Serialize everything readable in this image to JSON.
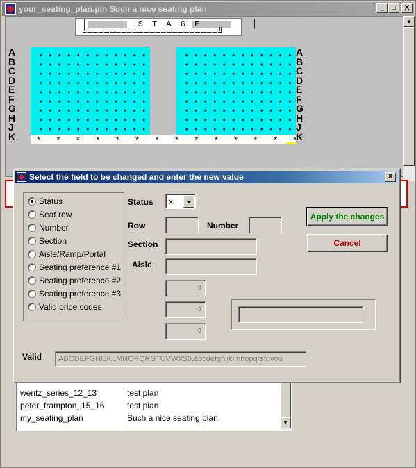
{
  "window": {
    "title": "your_seating_plan.pln Such a nice seating plan",
    "buttons": {
      "minimize": "_",
      "maximize": "□",
      "close": "X"
    }
  },
  "stage": {
    "line1": "║       S T A G E       ║",
    "line2": "╚═══════════════════════╝"
  },
  "rows": [
    "A",
    "B",
    "C",
    "D",
    "E",
    "F",
    "G",
    "H",
    "J",
    "K"
  ],
  "k_row_seats": "* * * * * * * * * * * * * * * * * * * *",
  "dialog": {
    "title": "Select the field to be changed and enter the new value",
    "close": "X",
    "fields": [
      "Status",
      "Seat row",
      "Number",
      "Section",
      "Aisle/Ramp/Portal",
      "Seating preference #1",
      "Seating preference #2",
      "Seating preference #3",
      "Valid price codes"
    ],
    "labels": {
      "status": "Status",
      "row": "Row",
      "number": "Number",
      "section": "Section",
      "aisle": "Aisle",
      "valid": "Valid"
    },
    "status_value": "x",
    "pref_values": [
      "0",
      "0",
      "0"
    ],
    "valid_codes": "ABCDEFGHIJKLMNOPQRSTUVWX$0.abcdefghijklmnopqrstuvwx",
    "apply_label": "Apply the changes",
    "cancel_label": "Cancel"
  },
  "list": {
    "rows": [
      {
        "name": "wentz_series_12_13",
        "desc": "test plan"
      },
      {
        "name": "peter_frampton_15_16",
        "desc": "test plan"
      },
      {
        "name": "my_seating_plan",
        "desc": "Such a nice seating plan"
      }
    ]
  }
}
